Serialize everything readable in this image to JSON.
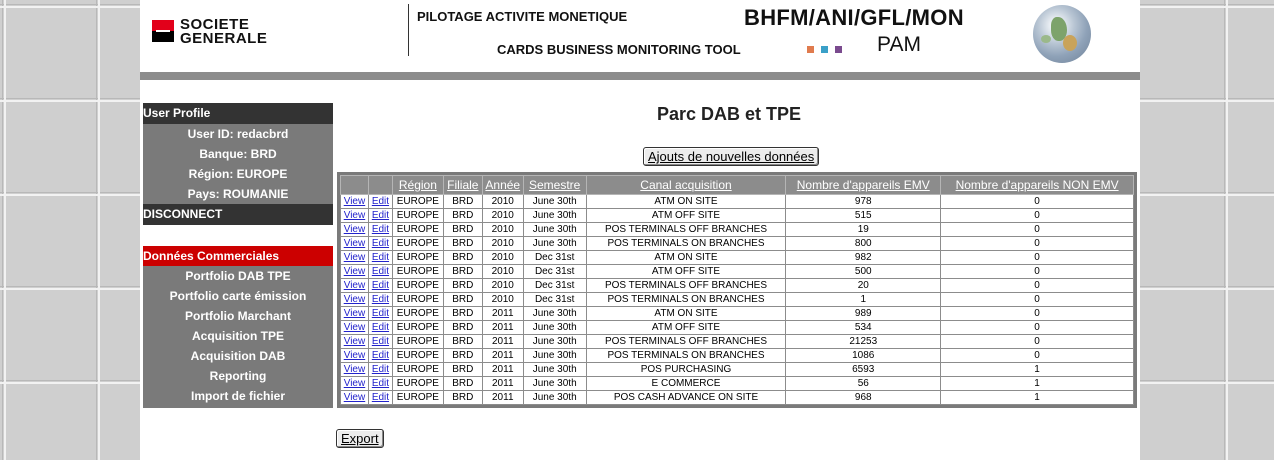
{
  "header": {
    "logo_line1": "SOCIETE",
    "logo_line2": "GENERALE",
    "title1": "PILOTAGE ACTIVITE MONETIQUE",
    "title2": "CARDS BUSINESS MONITORING TOOL",
    "title3": "BHFM/ANI/GFL/MON",
    "title4": "PAM",
    "dot_colors": [
      "#e07b4e",
      "#3aa0c8",
      "#7a4a8e"
    ]
  },
  "sidebar": {
    "profile_title": "User Profile",
    "user_id": "User ID: redacbrd",
    "bank": "Banque: BRD",
    "region": "Région: EUROPE",
    "country": "Pays: ROUMANIE",
    "disconnect": "DISCONNECT",
    "section_title": "Données Commerciales",
    "menu": [
      "Portfolio DAB TPE",
      "Portfolio carte émission",
      "Portfolio Marchant",
      "Acquisition TPE",
      "Acquisition DAB",
      "Reporting",
      "Import de fichier"
    ]
  },
  "main": {
    "page_title": "Parc DAB et TPE",
    "add_button": "Ajouts de nouvelles données",
    "export_button": "Export",
    "columns": [
      "",
      "",
      "Région",
      "Filiale",
      "Année",
      "Semestre",
      "Canal acquisition",
      "Nombre d'appareils EMV",
      "Nombre d'appareils NON EMV"
    ],
    "view_label": "View",
    "edit_label": "Edit",
    "rows": [
      [
        "EUROPE",
        "BRD",
        "2010",
        "June 30th",
        "ATM ON SITE",
        "978",
        "0"
      ],
      [
        "EUROPE",
        "BRD",
        "2010",
        "June 30th",
        "ATM OFF SITE",
        "515",
        "0"
      ],
      [
        "EUROPE",
        "BRD",
        "2010",
        "June 30th",
        "POS TERMINALS OFF BRANCHES",
        "19",
        "0"
      ],
      [
        "EUROPE",
        "BRD",
        "2010",
        "June 30th",
        "POS TERMINALS ON BRANCHES",
        "800",
        "0"
      ],
      [
        "EUROPE",
        "BRD",
        "2010",
        "Dec 31st",
        "ATM ON SITE",
        "982",
        "0"
      ],
      [
        "EUROPE",
        "BRD",
        "2010",
        "Dec 31st",
        "ATM OFF SITE",
        "500",
        "0"
      ],
      [
        "EUROPE",
        "BRD",
        "2010",
        "Dec 31st",
        "POS TERMINALS OFF BRANCHES",
        "20",
        "0"
      ],
      [
        "EUROPE",
        "BRD",
        "2010",
        "Dec 31st",
        "POS TERMINALS ON BRANCHES",
        "1",
        "0"
      ],
      [
        "EUROPE",
        "BRD",
        "2011",
        "June 30th",
        "ATM ON SITE",
        "989",
        "0"
      ],
      [
        "EUROPE",
        "BRD",
        "2011",
        "June 30th",
        "ATM OFF SITE",
        "534",
        "0"
      ],
      [
        "EUROPE",
        "BRD",
        "2011",
        "June 30th",
        "POS TERMINALS OFF BRANCHES",
        "21253",
        "0"
      ],
      [
        "EUROPE",
        "BRD",
        "2011",
        "June 30th",
        "POS TERMINALS ON BRANCHES",
        "1086",
        "0"
      ],
      [
        "EUROPE",
        "BRD",
        "2011",
        "June 30th",
        "POS PURCHASING",
        "6593",
        "1"
      ],
      [
        "EUROPE",
        "BRD",
        "2011",
        "June 30th",
        "E COMMERCE",
        "56",
        "1"
      ],
      [
        "EUROPE",
        "BRD",
        "2011",
        "June 30th",
        "POS CASH ADVANCE ON SITE",
        "968",
        "1"
      ]
    ]
  }
}
